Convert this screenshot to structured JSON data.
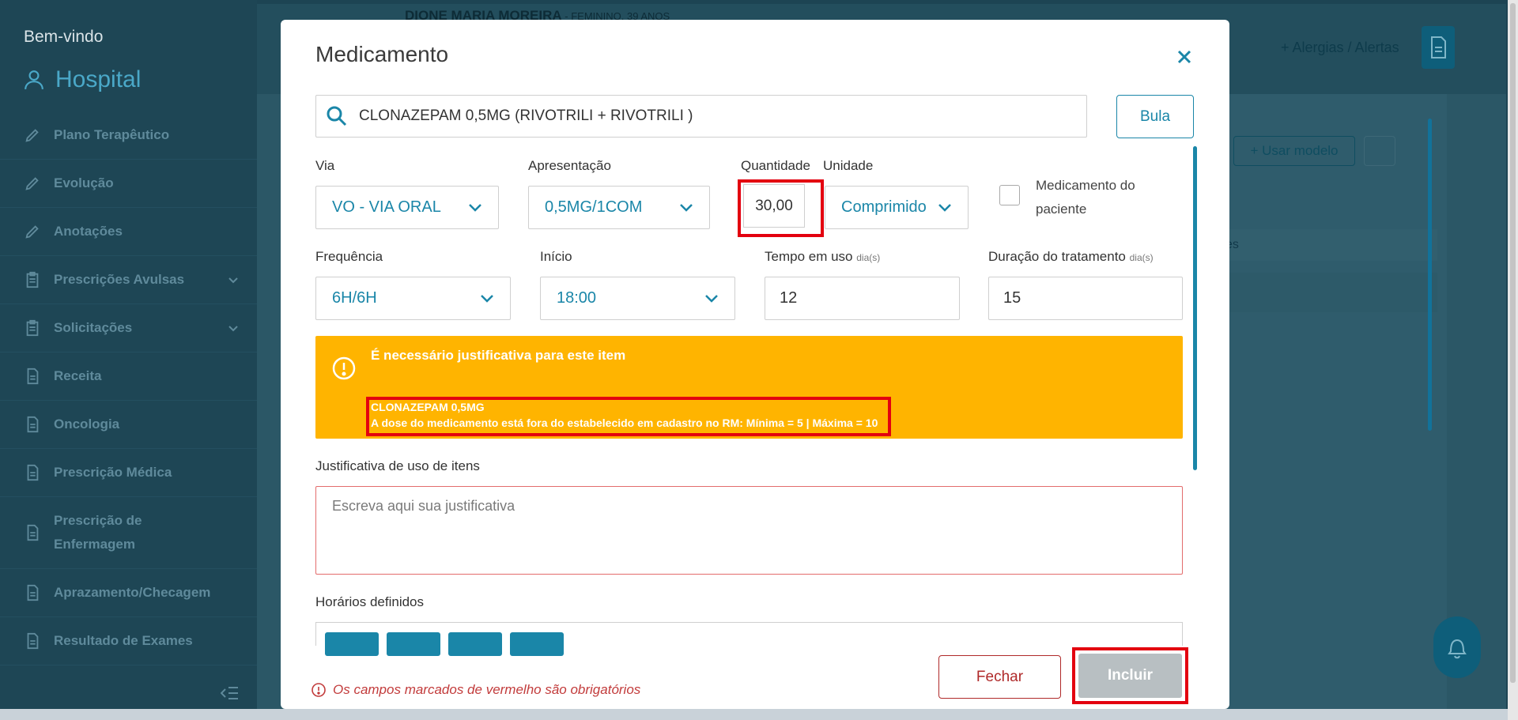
{
  "sidebar": {
    "welcome": "Bem-vindo",
    "hospital": "Hospital",
    "items": [
      {
        "label": "Plano Terapêutico"
      },
      {
        "label": "Evolução"
      },
      {
        "label": "Anotações"
      },
      {
        "label": "Prescrições Avulsas"
      },
      {
        "label": "Solicitações"
      },
      {
        "label": "Receita"
      },
      {
        "label": "Oncologia"
      },
      {
        "label": "Prescrição Médica"
      },
      {
        "label": "Prescrição de Enfermagem"
      },
      {
        "label": "Aprazamento/Checagem"
      },
      {
        "label": "Resultado de Exames"
      }
    ]
  },
  "header": {
    "patient_name": "DIONE MARIA MOREIRA",
    "patient_meta": " - FEMININO, 39 ANOS",
    "allergies_label": "+  Alergias / Alertas"
  },
  "background": {
    "usar_modelo": "+ Usar modelo",
    "row_text": "es"
  },
  "modal": {
    "title": "Medicamento",
    "search_value": "CLONAZEPAM 0,5MG (RIVOTRILI  + RIVOTRILI )",
    "bula": "Bula",
    "labels": {
      "via": "Via",
      "apresentacao": "Apresentação",
      "quantidade": "Quantidade",
      "unidade": "Unidade",
      "frequencia": "Frequência",
      "inicio": "Início",
      "tempo_uso": "Tempo em uso",
      "tempo_uso_unit": "dia(s)",
      "duracao": "Duração do tratamento",
      "duracao_unit": "dia(s)",
      "justificativa": "Justificativa de uso de itens",
      "horarios": "Horários definidos"
    },
    "values": {
      "via": "VO - VIA ORAL",
      "apresentacao": "0,5MG/1COM",
      "quantidade": "30,00",
      "unidade": "Comprimido",
      "frequencia": "6H/6H",
      "inicio": "18:00",
      "tempo_uso": "12",
      "duracao": "15"
    },
    "medicamento_paciente": "Medicamento do paciente",
    "alert": {
      "title": "É necessário justificativa para este item",
      "line1": "CLONAZEPAM 0,5MG",
      "line2": "A dose do medicamento está fora do estabelecido em cadastro no RM: Mínima = 5 | Máxima = 10"
    },
    "justificativa_placeholder": "Escreva aqui sua justificativa",
    "required_note": "Os campos marcados de vermelho são obrigatórios",
    "btn_fechar": "Fechar",
    "btn_incluir": "Incluir"
  },
  "colors": {
    "accent": "#1a86a8",
    "alert": "#ffb400",
    "danger": "#e3000f",
    "sidebar": "#1e4655"
  }
}
